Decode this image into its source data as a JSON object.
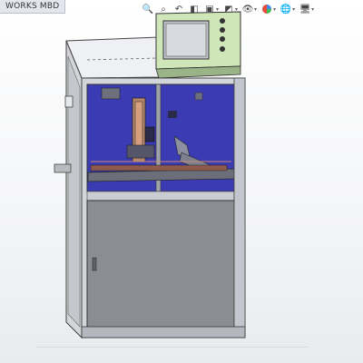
{
  "app": {
    "tab_label": "WORKS MBD"
  },
  "view_toolbar": {
    "icons": [
      "zoom-fit-icon",
      "zoom-area-icon",
      "previous-view-icon",
      "section-view-icon",
      "view-orientation-icon",
      "display-style-icon",
      "hide-show-items-icon",
      "edit-appearance-icon",
      "apply-scene-icon",
      "view-settings-icon"
    ]
  },
  "machine": {
    "panel_color": "#cfe7b8",
    "glass_color": "#3b3bb4",
    "frame_color": "#c9ccd2",
    "cabinet_color": "#8a8d91"
  }
}
